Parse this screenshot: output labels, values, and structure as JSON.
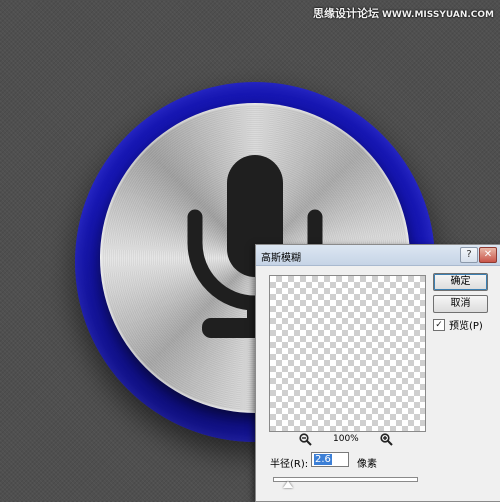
{
  "watermark": {
    "text": "思缘设计论坛",
    "url": "WWW.MISSYUAN.COM"
  },
  "artwork": {
    "ring_color": "#1a1ac8",
    "knob_color": "#c0c0c0",
    "icon": "microphone-icon",
    "icon_color": "#1e1e1e"
  },
  "dialog": {
    "title": "高斯模糊",
    "help_label": "?",
    "close_label": "✕",
    "ok_label": "确定",
    "cancel_label": "取消",
    "preview_label": "预览(P)",
    "preview_checked": true,
    "zoom_out_icon": "zoom-out-icon",
    "zoom_level": "100%",
    "zoom_in_icon": "zoom-in-icon",
    "radius_label": "半径(R):",
    "radius_value": "2.6",
    "radius_unit": "像素",
    "radius_slider_fraction": 0.1
  }
}
